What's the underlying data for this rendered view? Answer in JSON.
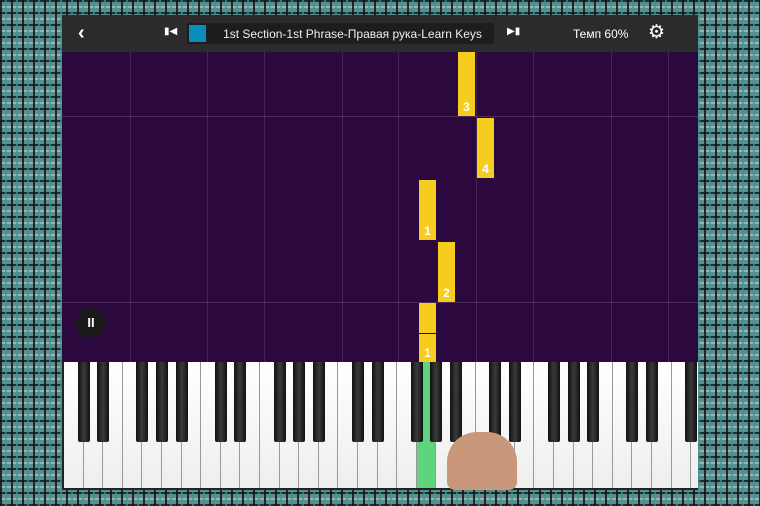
{
  "toolbar": {
    "back_icon": "chevron-left-icon",
    "prev_icon": "skip-previous-icon",
    "title": "1st Section-1st Phrase-Правая рука-Learn Keys",
    "next_icon": "skip-next-icon",
    "tempo_label": "Темп 60%",
    "settings_icon": "gear-icon",
    "title_color": "#0a8cbf"
  },
  "notes": [
    {
      "finger": "3"
    },
    {
      "finger": "4"
    },
    {
      "finger": "1"
    },
    {
      "finger": "2"
    },
    {
      "finger": ""
    },
    {
      "finger": "1"
    }
  ],
  "player": {
    "pause_icon": "pause-icon",
    "pause_label": "II"
  },
  "colors": {
    "note": "#f6cd1f",
    "roll_bg": "#2b083d",
    "active_key": "#5fd37e"
  }
}
